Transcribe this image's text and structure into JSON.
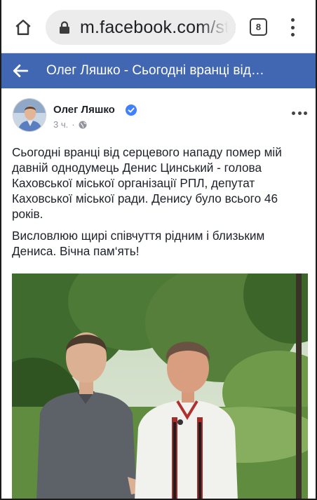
{
  "browser": {
    "url": "m.facebook.com/sto",
    "tab_count": "8",
    "icons": {
      "home": "home-icon",
      "lock": "lock-icon",
      "menu": "more-vert-icon"
    }
  },
  "fb_header": {
    "title": "Олег Ляшко - Сьогодні вранці від…",
    "bg_color": "#4267b2"
  },
  "post": {
    "author": "Олег Ляшко",
    "verified": true,
    "time": "3 ч.",
    "privacy_icon": "globe-icon",
    "paragraphs": [
      "Сьогодні вранці від серцевого нападу помер мій давній однодумець Денис Цинський - голова Каховської міської організації РПЛ, депутат Каховської міської ради. Денису було всього 46 років.",
      "Висловлюю щирі співчуття рідним і близьким Дениса. Вічна пам‘ять!"
    ]
  }
}
